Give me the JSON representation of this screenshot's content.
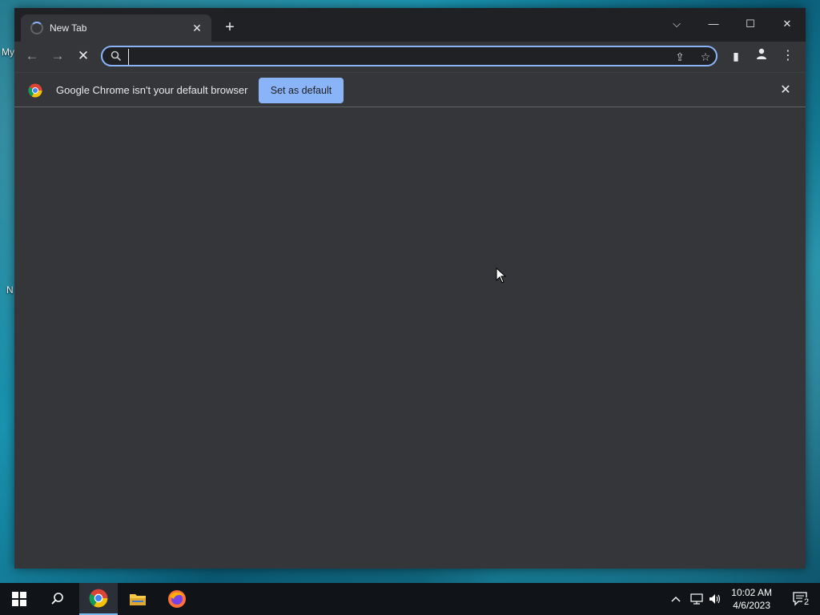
{
  "desktop": {
    "icon_labels": [
      "My",
      "N"
    ]
  },
  "window": {
    "tab": {
      "title": "New Tab",
      "close": "✕"
    },
    "new_tab": "+",
    "controls": {
      "dropdown": "⌵",
      "minimize": "—",
      "maximize": "☐",
      "close": "✕"
    }
  },
  "toolbar": {
    "back": "←",
    "forward": "→",
    "stop": "✕",
    "omnibox": {
      "value": "",
      "placeholder": ""
    },
    "share": "⇪",
    "bookmark": "☆",
    "side_panel": "▮",
    "menu": "⋮"
  },
  "infobar": {
    "message": "Google Chrome isn't your default browser",
    "button_label": "Set as default",
    "close": "✕"
  },
  "taskbar": {
    "clock_time": "10:02 AM",
    "clock_date": "4/6/2023",
    "notification_count": "2",
    "tray_chevron": "^"
  },
  "colors": {
    "accent": "#8ab4f8",
    "window_bg": "#35363a",
    "titlebar_bg": "#202124",
    "taskbar_bg": "#101418"
  }
}
